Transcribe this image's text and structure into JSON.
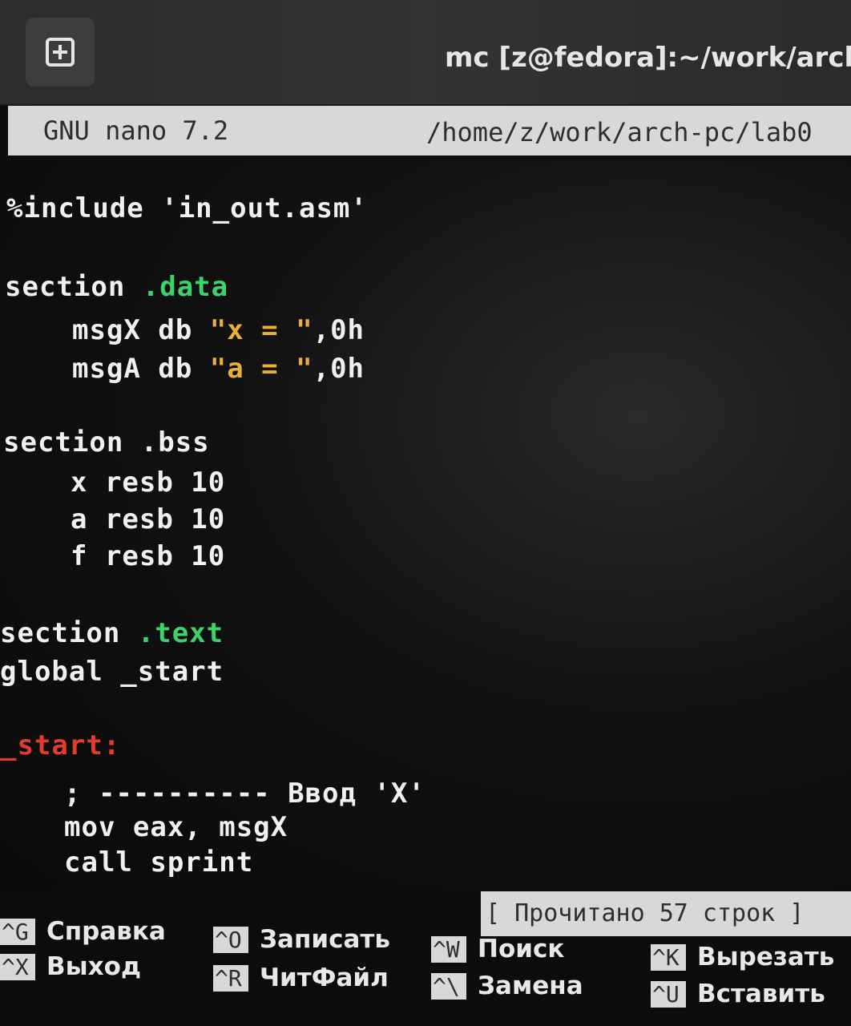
{
  "window": {
    "title": "mc [z@fedora]:~/work/arch",
    "new_tab_icon": "plus-square-icon"
  },
  "nano": {
    "version": "GNU nano 7.2",
    "path": "/home/z/work/arch-pc/lab0"
  },
  "code": {
    "include": "%include 'in_out.asm'",
    "section_data_kw": "section ",
    "section_data_name": ".data",
    "msgx_prefix": "msgX db ",
    "msgx_str": "\"x = \"",
    "msgx_suffix": ",0h",
    "msga_prefix": "msgA db ",
    "msga_str": "\"a = \"",
    "msga_suffix": ",0h",
    "section_bss": "section .bss",
    "res_x": "x resb 10",
    "res_a": "a resb 10",
    "res_f": "f resb 10",
    "section_text_kw": "section ",
    "section_text_name": ".text",
    "global": "global _start",
    "label": "_start:",
    "comment": "; ---------- Ввод 'X'",
    "mov": "mov eax, msgX",
    "call": "call sprint"
  },
  "status": {
    "message": "[ Прочитано 57 строк ]"
  },
  "shortcuts": [
    {
      "key": "^G",
      "label": "Справка"
    },
    {
      "key": "^X",
      "label": "Выход"
    },
    {
      "key": "^O",
      "label": "Записать"
    },
    {
      "key": "^R",
      "label": "ЧитФайл"
    },
    {
      "key": "^W",
      "label": "Поиск"
    },
    {
      "key": "^\\",
      "label": "Замена"
    },
    {
      "key": "^K",
      "label": "Вырезать"
    },
    {
      "key": "^U",
      "label": "Вставить"
    }
  ]
}
